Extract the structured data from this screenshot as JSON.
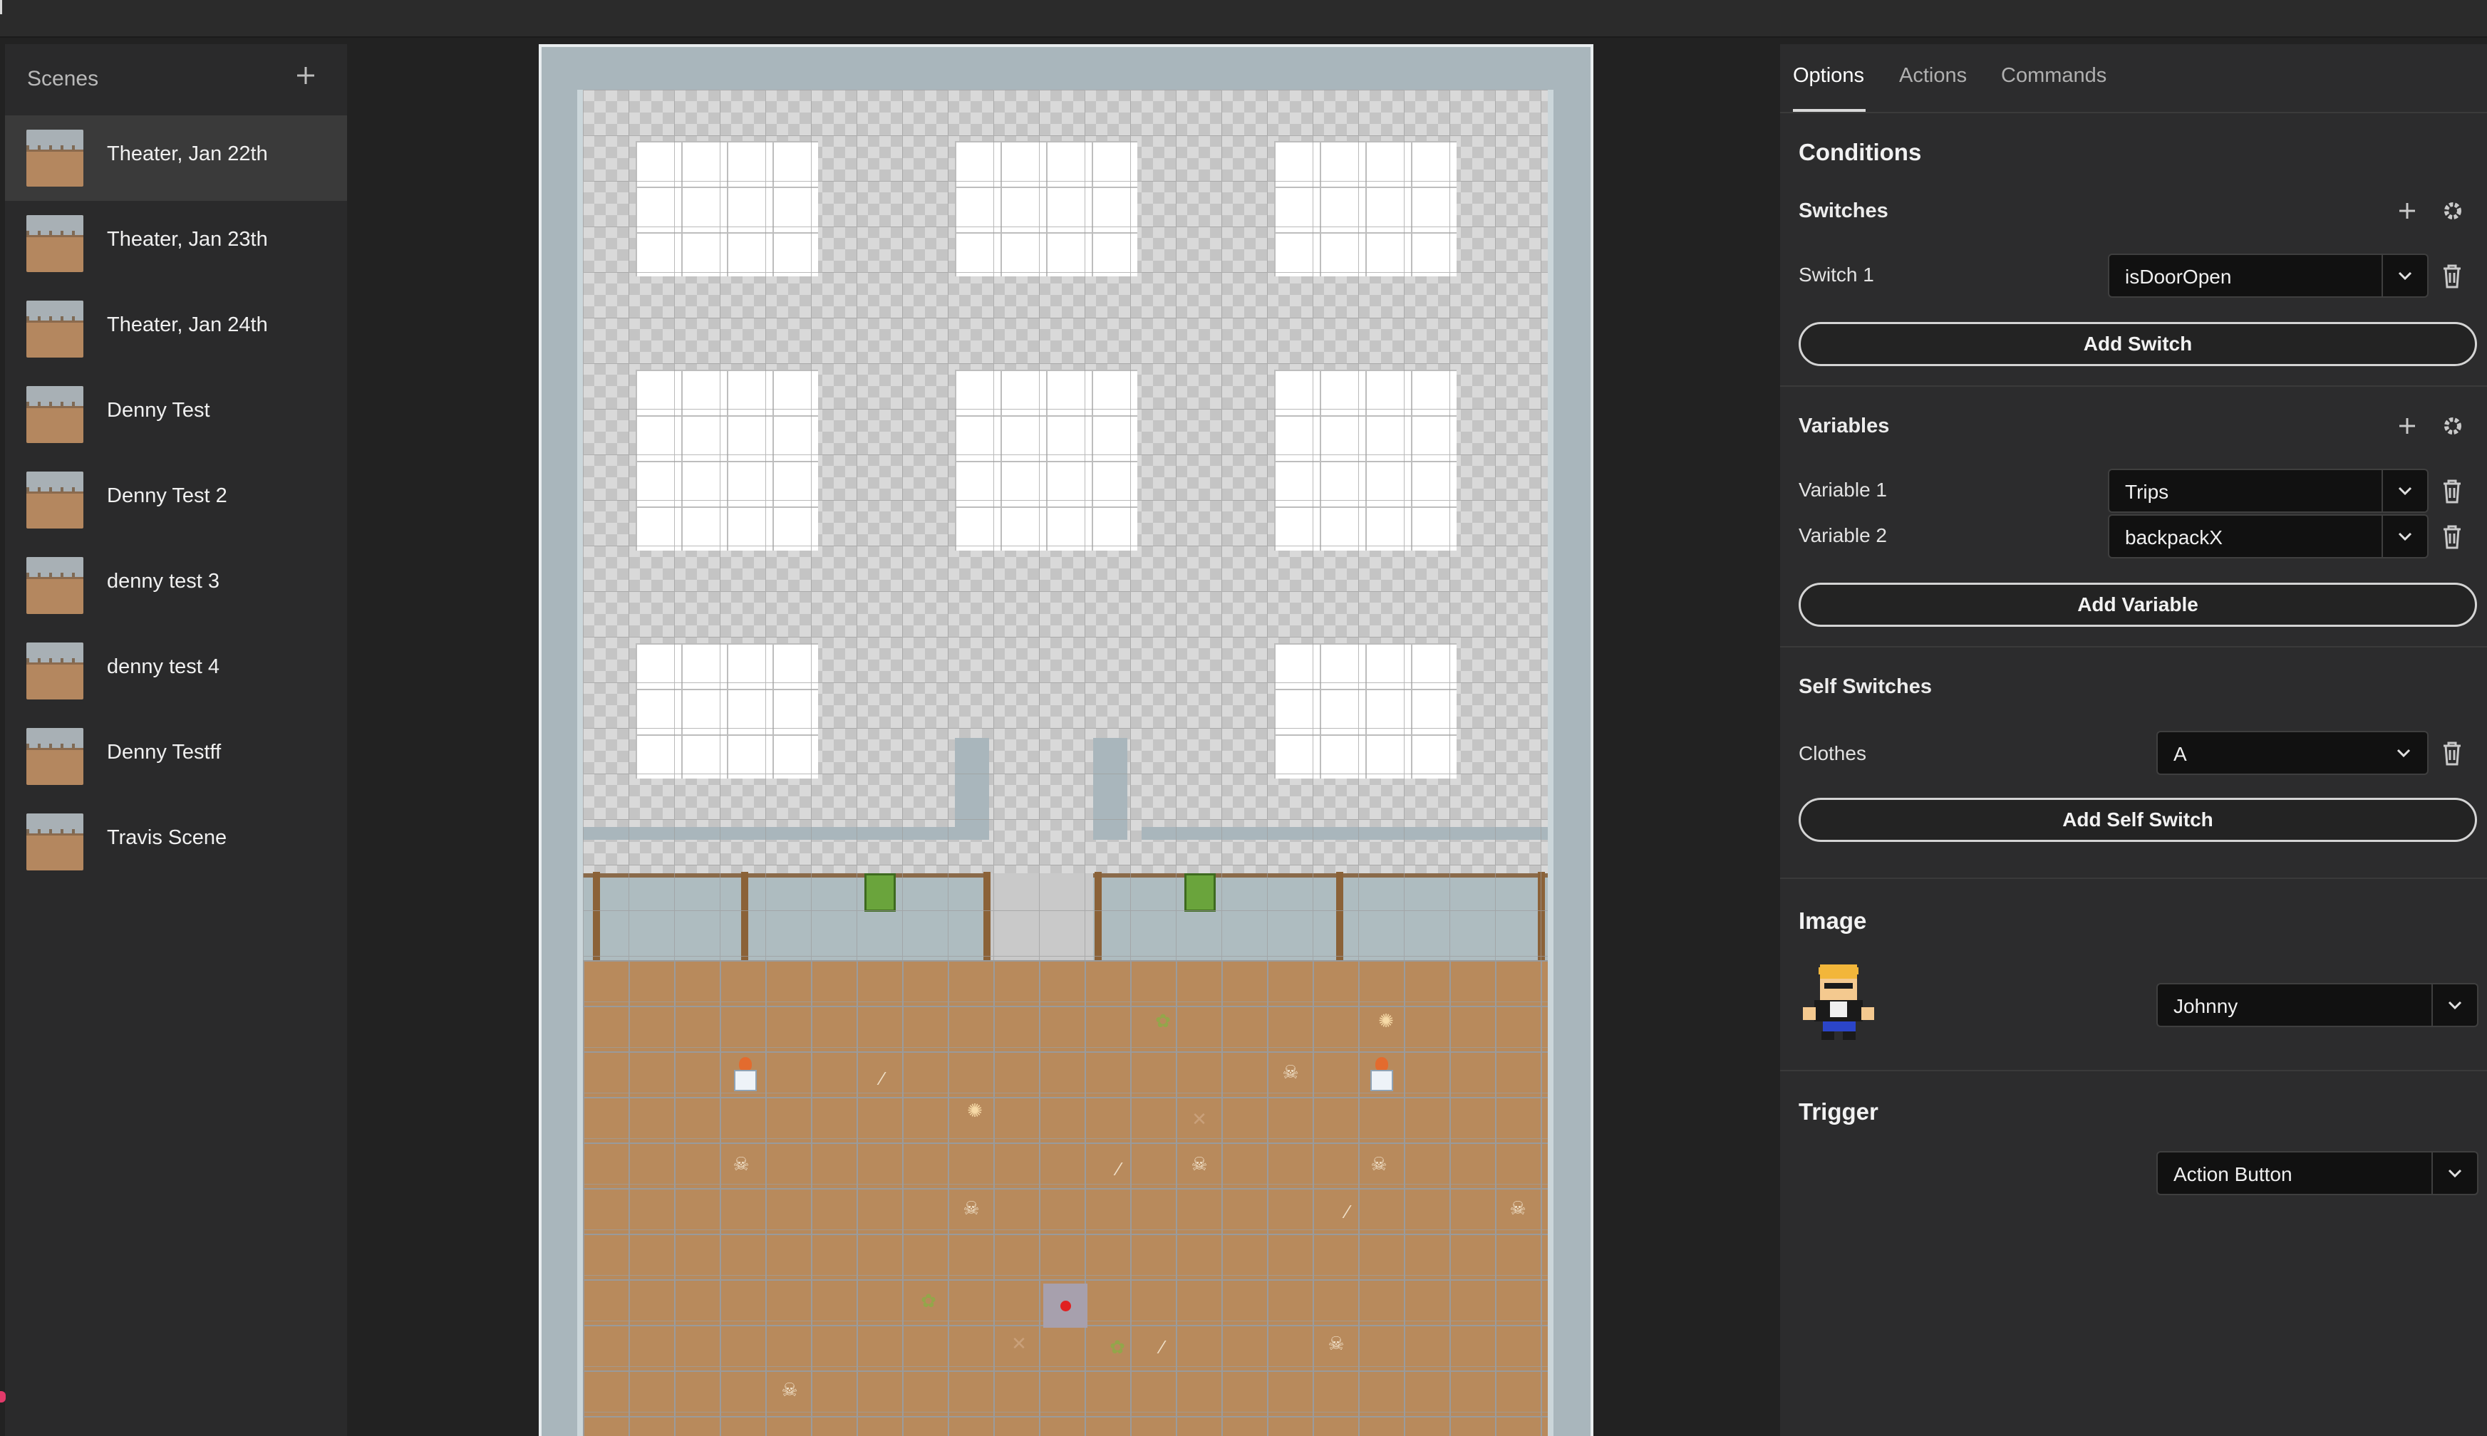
{
  "sidebar": {
    "title": "Scenes",
    "add_icon": "plus-icon",
    "scenes": [
      {
        "label": "Theater, Jan 22th",
        "active": true
      },
      {
        "label": "Theater, Jan 23th",
        "active": false
      },
      {
        "label": "Theater, Jan 24th",
        "active": false
      },
      {
        "label": "Denny Test",
        "active": false
      },
      {
        "label": "Denny Test 2",
        "active": false
      },
      {
        "label": "denny test 3",
        "active": false
      },
      {
        "label": "denny test 4",
        "active": false
      },
      {
        "label": "Denny Testff",
        "active": false
      },
      {
        "label": "Travis Scene",
        "active": false
      }
    ]
  },
  "tabs": {
    "options": "Options",
    "actions": "Actions",
    "commands": "Commands",
    "active": "Options"
  },
  "conditions": {
    "title": "Conditions",
    "switches": {
      "title": "Switches",
      "items": [
        {
          "label": "Switch 1",
          "value": "isDoorOpen"
        }
      ],
      "add_label": "Add Switch"
    },
    "variables": {
      "title": "Variables",
      "items": [
        {
          "label": "Variable 1",
          "value": "Trips"
        },
        {
          "label": "Variable 2",
          "value": "backpackX"
        }
      ],
      "add_label": "Add Variable"
    },
    "self_switches": {
      "title": "Self Switches",
      "items": [
        {
          "label": "Clothes",
          "value": "A"
        }
      ],
      "add_label": "Add Self Switch"
    }
  },
  "image": {
    "title": "Image",
    "value": "Johnny"
  },
  "trigger": {
    "title": "Trigger",
    "value": "Action Button"
  },
  "colors": {
    "background": "#222222",
    "panel": "#2c2c2d",
    "floor": "#b88a5c",
    "wall": "#a9b6bc",
    "start_marker": "#e02020"
  }
}
